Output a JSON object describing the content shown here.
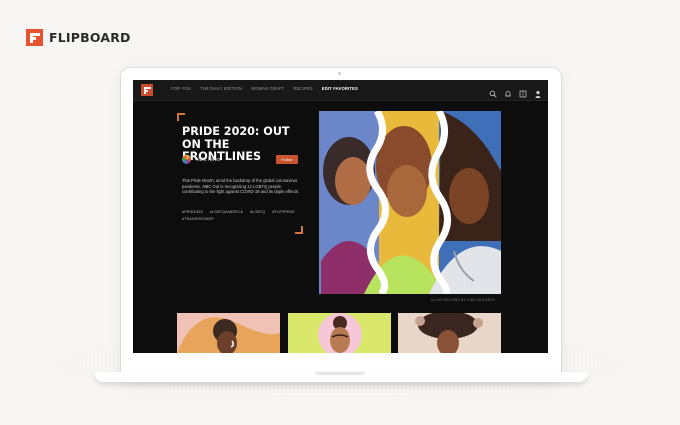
{
  "brand": {
    "name": "FLIPBOARD",
    "icon": "flipboard-logo-icon"
  },
  "app": {
    "nav": {
      "tabs": [
        "For You",
        "The Daily Edition",
        "Woman Craft",
        "Recipes",
        "Edit Favorites"
      ],
      "active_tab_index": 4,
      "icons": [
        "search-icon",
        "bell-icon",
        "grid-icon",
        "profile-icon"
      ]
    },
    "hero": {
      "title": "PRIDE 2020: OUT ON THE FRONTLINES",
      "publisher": "NBC News",
      "follow_label": "Follow",
      "description": "This Pride Month, amid the backdrop of the global coronavirus pandemic, NBC Out is recognizing 12 LGBTQ people contributing to the fight against COVID-19 and its ripple effects.",
      "tags": [
        "#PRIDE365",
        "#LGBTQAMERICA",
        "#LGBTQ",
        "#FLIPPRIDE",
        "#TRANSGENDER"
      ],
      "image_caption": "Illustrations by Chelsea Beck"
    }
  },
  "colors": {
    "accent": "#c9542f",
    "brand_logo": "#e8532f",
    "screen_bg": "#0d0d0d"
  }
}
